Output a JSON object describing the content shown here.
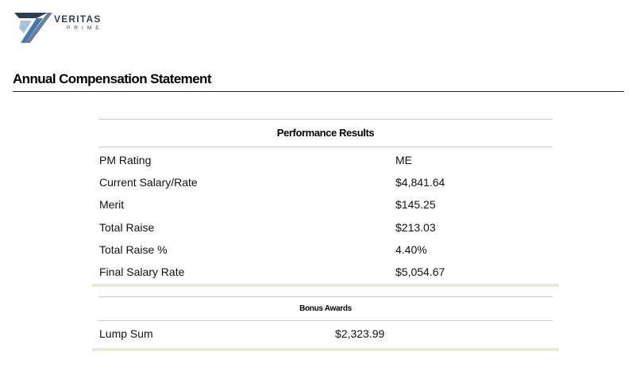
{
  "brand": {
    "name": "VERITAS",
    "sub": "PRIME"
  },
  "page": {
    "title": "Annual Compensation Statement"
  },
  "performance": {
    "heading": "Performance Results",
    "rows": [
      {
        "label": "PM Rating",
        "value": "ME"
      },
      {
        "label": "Current Salary/Rate",
        "value": "$4,841.64"
      },
      {
        "label": "Merit",
        "value": "$145.25"
      },
      {
        "label": "Total Raise",
        "value": "$213.03"
      },
      {
        "label": "Total Raise %",
        "value": "4.40%"
      },
      {
        "label": "Final Salary Rate",
        "value": "$5,054.67"
      }
    ]
  },
  "bonus": {
    "heading": "Bonus Awards",
    "rows": [
      {
        "label": "Lump Sum",
        "value": "$2,323.99"
      }
    ]
  },
  "colors": {
    "band": "#eae8d9",
    "rule": "#222222",
    "brand_navy": "#2f3f52",
    "brand_blue": "#3d79b8"
  }
}
